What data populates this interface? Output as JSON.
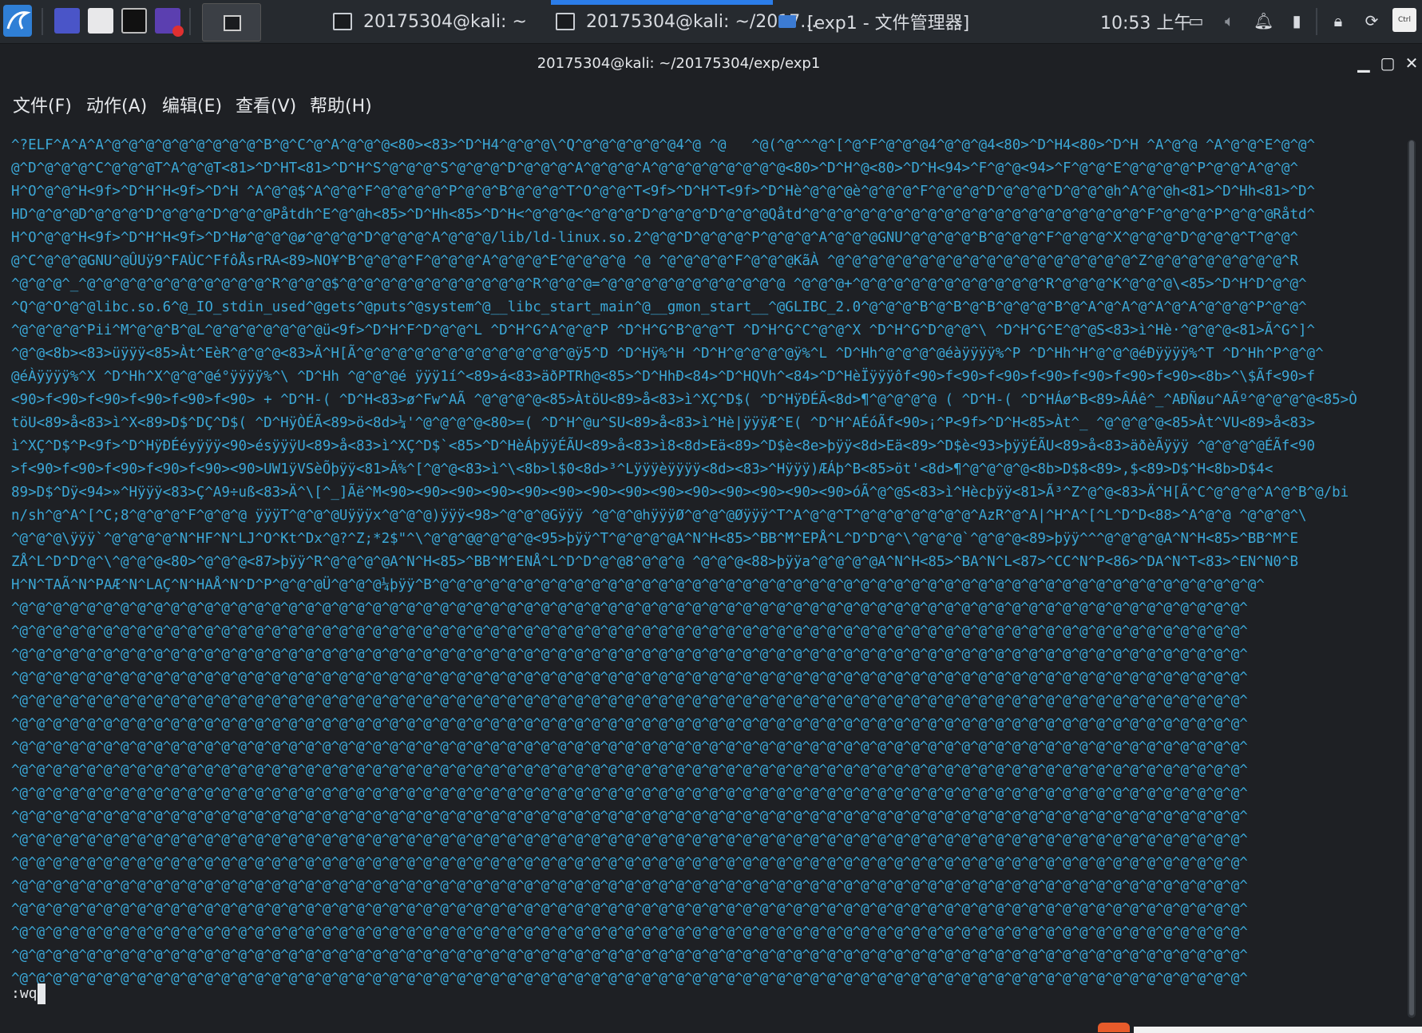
{
  "taskbar": {
    "windows": [
      {
        "label": "20175304@kali: ~"
      },
      {
        "label": "20175304@kali: ~/2017..."
      },
      {
        "label": "[exp1 - 文件管理器]"
      }
    ],
    "clock": "10:53 上午"
  },
  "window": {
    "title": "20175304@kali: ~/20175304/exp/exp1",
    "menu": [
      "文件(F)",
      "动作(A)",
      "编辑(E)",
      "查看(V)",
      "帮助(H)"
    ]
  },
  "terminal": {
    "lines": [
      "^?ELF^A^A^A^@^@^@^@^@^@^@^@^@^B^@^C^@^A^@^@^@<80><83>^D^H4^@^@^@\\^Q^@^@^@^@^@^@4^@ ^@   ^@(^@^^^@^[^@^F^@^@^@4^@^@^@4<80>^D^H4<80>^D^H ^A^@^@ ^A^@^@^E^@^@^",
      "@^D^@^@^@^C^@^@^@T^A^@^@T<81>^D^HT<81>^D^H^S^@^@^@^S^@^@^@^D^@^@^@^A^@^@^@^A^@^@^@^@^@^@^@^@<80>^D^H^@<80>^D^H<94>^F^@^@<94>^F^@^@^E^@^@^@^@^P^@^@^A^@^@^",
      "H^O^@^@^H<9f>^D^H^H<9f>^D^H ^A^@^@$^A^@^@^F^@^@^@^@^P^@^@^B^@^@^@^T^O^@^@^T<9f>^D^H^T<9f>^D^Hè^@^@^@è^@^@^@^F^@^@^@^D^@^@^@^D^@^@^@h^A^@^@h<81>^D^Hh<81>^D^",
      "HD^@^@^@D^@^@^@^D^@^@^@^D^@^@^@Påtdh^E^@^@h<85>^D^Hh<85>^D^H<^@^@^@<^@^@^@^D^@^@^@^D^@^@^@Qåtd^@^@^@^@^@^@^@^@^@^@^@^@^@^@^@^@^@^@^@^@^F^@^@^@^P^@^@^@Råtd^",
      "H^O^@^@^H<9f>^D^H^H<9f>^D^Hø^@^@^@ø^@^@^@^D^@^@^@^A^@^@^@/lib/ld-linux.so.2^@^@^D^@^@^@^P^@^@^@^A^@^@^@GNU^@^@^@^@^B^@^@^@^F^@^@^@^X^@^@^@^D^@^@^@^T^@^@^",
      "@^C^@^@^@GNU^@ÛUÿ9^FAÙC^FfôÅsrRA<89>NO¥^B^@^@^@^F^@^@^@^A^@^@^@^E^@^@^@^@ ^@ ^@^@^@^@^F^@^@^@KãÀ ^@^@^@^@^@^@^@^@^@^@^@^@^@^@^@^@^@^@^Z^@^@^@^@^@^@^@^@^R",
      "^@^@^@^_^@^@^@^@^@^@^@^@^@^@^@^R^@^@^@$^@^@^@^@^@^@^@^@^@^@^@^R^@^@^@=^@^@^@^@^@^@^@^@^@^@^@ ^@^@^@+^@^@^@^@^@^@^@^@^@^@^@^R^@^@^@^K^@^@^@\\<85>^D^H^D^@^@^",
      "^Q^@^O^@^@libc.so.6^@_IO_stdin_used^@gets^@puts^@system^@__libc_start_main^@__gmon_start__^@GLIBC_2.0^@^@^@^B^@^B^@^B^@^@^@^B^@^A^@^A^@^A^@^A^@^@^@^P^@^@^",
      "^@^@^@^@^Pii^M^@^@^B^@L^@^@^@^@^@^@^@ü<9f>^D^H^F^D^@^@^L ^D^H^G^A^@^@^P ^D^H^G^B^@^@^T ^D^H^G^C^@^@^X ^D^H^G^D^@^@^\\ ^D^H^G^E^@^@S<83>ì^Hè·^@^@^@<81>Ã^G^]^",
      "^@^@<8b><83>üÿÿÿ<85>Àt^EèR^@^@^@<83>Ä^H[Ã^@^@^@^@^@^@^@^@^@^@^@^@^@ÿ5^D ^D^Hÿ%^H ^D^H^@^@^@^@ÿ%^L ^D^Hh^@^@^@^@éàÿÿÿÿ%^P ^D^Hh^H^@^@^@éÐÿÿÿÿ%^T ^D^Hh^P^@^@^",
      "@éÀÿÿÿÿ%^X ^D^Hh^X^@^@^@é°ÿÿÿÿ%^\\ ^D^Hh ^@^@^@é ÿÿÿ1í^<89>á<83>äðPTRh@<85>^D^HhÐ<84>^D^HQVh^<84>^D^HèÏÿÿÿôf<90>f<90>f<90>f<90>f<90>f<90>f<90><8b>^\\$Ãf<90>f",
      "<90>f<90>f<90>f<90>f<90>f<90> + ^D^H-( ^D^H<83>ø^Fw^AÃ ^@^@^@^@<85>ÀtöU<89>å<83>ì^XÇ^D$( ^D^HÿÐÉÃ<8d>¶^@^@^@^@ ( ^D^H-( ^D^HÁø^B<89>ÂÁê^_^AÐÑøu^AÃº^@^@^@^@<85>Ò",
      "töU<89>å<83>ì^X<89>D$^DÇ^D$( ^D^HÿÒÉÃ<89>ö<8d>¼'^@^@^@^@<80>=( ^D^H^@u^SU<89>å<83>ì^Hè|ÿÿÿÆ^E( ^D^H^AÉóÃf<90>¡^P<9f>^D^H<85>Àt^_ ^@^@^@^@<85>Àt^VU<89>å<83>",
      "ì^XÇ^D$^P<9f>^D^HÿÐÉéyÿÿÿ<90>ésÿÿÿU<89>å<83>ì^XÇ^D$`<85>^D^HèÁþÿÿÉÃU<89>å<83>ì8<8d>Eä<89>^D$è<8e>þÿÿ<8d>Eä<89>^D$è<93>þÿÿÉÃU<89>å<83>äðèÃÿÿÿ ^@^@^@^@ÉÃf<90",
      ">f<90>f<90>f<90>f<90>f<90><90>UW1ÿVSèÕþÿÿ<81>Ã%^[^@^@<83>ì^\\<8b>l$0<8d>³^Lÿÿÿèÿÿÿÿ<8d><83>^Hÿÿÿ)ÆÁþ^B<85>öt'<8d>¶^@^@^@^@<8b>D$8<89>,$<89>D$^H<8b>D$4<",
      "89>D$^Dÿ<94>»^Hÿÿÿ<83>Ç^A9÷uß<83>Ä^\\[^_]Ãë^M<90><90><90><90><90><90><90><90><90><90><90><90><90><90>óÃ^@^@S<83>ì^Hècþÿÿ<81>Ã³^Z^@^@<83>Ä^H[Ã^C^@^@^@^A^@^B^@/bi",
      "n/sh^@^A^[^C;8^@^@^@^F^@^@^@ ÿÿÿT^@^@^@Uÿÿÿx^@^@^@)ÿÿÿ<98>^@^@^@Gÿÿÿ ^@^@^@hÿÿÿØ^@^@^@Øÿÿÿ^T^A^@^@^T^@^@^@^@^@^@^@^AzR^@^A|^H^A^[^L^D^D<88>^A^@^@ ^@^@^@^\\",
      "^@^@^@\\ÿÿÿ`^@^@^@^@^N^HF^N^LJ^O^Kt^Dx^@?^Z;*2$\"^\\^@^@^@@^@^@^@<95>þÿÿ^T^@^@^@^@A^N^H<85>^BB^M^EPÅ^L^D^D^@^\\^@^@^@`^@^@^@<89>þÿÿ^^^@^@^@^@A^N^H<85>^BB^M^E",
      "ZÅ^L^D^D^@^\\^@^@^@<80>^@^@^@<87>þÿÿ^R^@^@^@^@A^N^H<85>^BB^M^ENÅ^L^D^D^@^@8^@^@^@ ^@^@^@<88>þÿÿa^@^@^@^@A^N^H<85>^BA^N^L<87>^CC^N^P<86>^DA^N^T<83>^EN^N0^B",
      "H^N^TAÃ^N^PAÆ^N^LAÇ^N^HAÅ^N^D^P^@^@^@Ü^@^@^@¼þÿÿ^B^@^@^@^@^@^@^@^@^@^@^@^@^@^@^@^@^@^@^@^@^@^@^@^@^@^@^@^@^@^@^@^@^@^@^@^@^@^@^@^@^@^@^@^@^@^@^@^@^@^",
      "^@^@^@^@^@^@^@^@^@^@^@^@^@^@^@^@^@^@^@^@^@^@^@^@^@^@^@^@^@^@^@^@^@^@^@^@^@^@^@^@^@^@^@^@^@^@^@^@^@^@^@^@^@^@^@^@^@^@^@^@^@^@^@^@^@^@^@^@^@^@^@^@^@^",
      "^@^@^@^@^@^@^@^@^@^@^@^@^@^@^@^@^@^@^@^@^@^@^@^@^@^@^@^@^@^@^@^@^@^@^@^@^@^@^@^@^@^@^@^@^@^@^@^@^@^@^@^@^@^@^@^@^@^@^@^@^@^@^@^@^@^@^@^@^@^@^@^@^@^",
      "^@^@^@^@^@^@^@^@^@^@^@^@^@^@^@^@^@^@^@^@^@^@^@^@^@^@^@^@^@^@^@^@^@^@^@^@^@^@^@^@^@^@^@^@^@^@^@^@^@^@^@^@^@^@^@^@^@^@^@^@^@^@^@^@^@^@^@^@^@^@^@^@^@^",
      "^@^@^@^@^@^@^@^@^@^@^@^@^@^@^@^@^@^@^@^@^@^@^@^@^@^@^@^@^@^@^@^@^@^@^@^@^@^@^@^@^@^@^@^@^@^@^@^@^@^@^@^@^@^@^@^@^@^@^@^@^@^@^@^@^@^@^@^@^@^@^@^@^@^",
      "^@^@^@^@^@^@^@^@^@^@^@^@^@^@^@^@^@^@^@^@^@^@^@^@^@^@^@^@^@^@^@^@^@^@^@^@^@^@^@^@^@^@^@^@^@^@^@^@^@^@^@^@^@^@^@^@^@^@^@^@^@^@^@^@^@^@^@^@^@^@^@^@^@^",
      "^@^@^@^@^@^@^@^@^@^@^@^@^@^@^@^@^@^@^@^@^@^@^@^@^@^@^@^@^@^@^@^@^@^@^@^@^@^@^@^@^@^@^@^@^@^@^@^@^@^@^@^@^@^@^@^@^@^@^@^@^@^@^@^@^@^@^@^@^@^@^@^@^@^",
      "^@^@^@^@^@^@^@^@^@^@^@^@^@^@^@^@^@^@^@^@^@^@^@^@^@^@^@^@^@^@^@^@^@^@^@^@^@^@^@^@^@^@^@^@^@^@^@^@^@^@^@^@^@^@^@^@^@^@^@^@^@^@^@^@^@^@^@^@^@^@^@^@^@^",
      "^@^@^@^@^@^@^@^@^@^@^@^@^@^@^@^@^@^@^@^@^@^@^@^@^@^@^@^@^@^@^@^@^@^@^@^@^@^@^@^@^@^@^@^@^@^@^@^@^@^@^@^@^@^@^@^@^@^@^@^@^@^@^@^@^@^@^@^@^@^@^@^@^@^",
      "^@^@^@^@^@^@^@^@^@^@^@^@^@^@^@^@^@^@^@^@^@^@^@^@^@^@^@^@^@^@^@^@^@^@^@^@^@^@^@^@^@^@^@^@^@^@^@^@^@^@^@^@^@^@^@^@^@^@^@^@^@^@^@^@^@^@^@^@^@^@^@^@^@^",
      "^@^@^@^@^@^@^@^@^@^@^@^@^@^@^@^@^@^@^@^@^@^@^@^@^@^@^@^@^@^@^@^@^@^@^@^@^@^@^@^@^@^@^@^@^@^@^@^@^@^@^@^@^@^@^@^@^@^@^@^@^@^@^@^@^@^@^@^@^@^@^@^@^@^",
      "^@^@^@^@^@^@^@^@^@^@^@^@^@^@^@^@^@^@^@^@^@^@^@^@^@^@^@^@^@^@^@^@^@^@^@^@^@^@^@^@^@^@^@^@^@^@^@^@^@^@^@^@^@^@^@^@^@^@^@^@^@^@^@^@^@^@^@^@^@^@^@^@^@^",
      "^@^@^@^@^@^@^@^@^@^@^@^@^@^@^@^@^@^@^@^@^@^@^@^@^@^@^@^@^@^@^@^@^@^@^@^@^@^@^@^@^@^@^@^@^@^@^@^@^@^@^@^@^@^@^@^@^@^@^@^@^@^@^@^@^@^@^@^@^@^@^@^@^@^",
      "^@^@^@^@^@^@^@^@^@^@^@^@^@^@^@^@^@^@^@^@^@^@^@^@^@^@^@^@^@^@^@^@^@^@^@^@^@^@^@^@^@^@^@^@^@^@^@^@^@^@^@^@^@^@^@^@^@^@^@^@^@^@^@^@^@^@^@^@^@^@^@^@^@^",
      "^@^@^@^@^@^@^@^@^@^@^@^@^@^@^@^@^@^@^@^@^@^@^@^@^@^@^@^@^@^@^@^@^@^@^@^@^@^@^@^@^@^@^@^@^@^@^@^@^@^@^@^@^@^@^@^@^@^@^@^@^@^@^@^@^@^@^@^@^@^@^@^@^@^",
      "^@^@^@^@^@^@^@^@^@^@^@^@^@^@^@^@^@^@^@^@^@^@^@^@^@^@^@^@^@^@^@^@^@^@^@^@^@^@^@^@^@^@^@^@^@^@^@^@^@^@^@^@^@^@^@^@^@^@^@^@^@^@^@^@^@^@^@^@^@^@^@^@^@^",
      "^@^@^@^@^@^@^@^@^@^@^@^@^@^@^@^@^@^@^@^@^@^@^@^@^@^@^@^@^@^@^@^@^@^@^@^@^@^@^@^@^@^@^@^@^@^@^@^@^@^@^@^@^@^@^@^@^@^@^@^@^@^@^@^@^@^@^@^@^@^@^@^@^@^",
      "^@^@^@^@^@^@^@^@^@^@^@^@^@^@^@^@^@^@^@^@^@^@^@^@^@^@^@^@^@^@^@^@^@^@^@^@^@^@^@^@^@^@^@^@^@^@^@^@^@^@^@^@^@^@^@^@^@^@^@^@^@^@^@^@^@^@^@^@^@^@^@^@^@^"
    ],
    "command": ":wq"
  },
  "colors": {
    "binary_text": "#3ba7d6",
    "background": "#1e2024",
    "active_indicator": "#2b7de9"
  }
}
